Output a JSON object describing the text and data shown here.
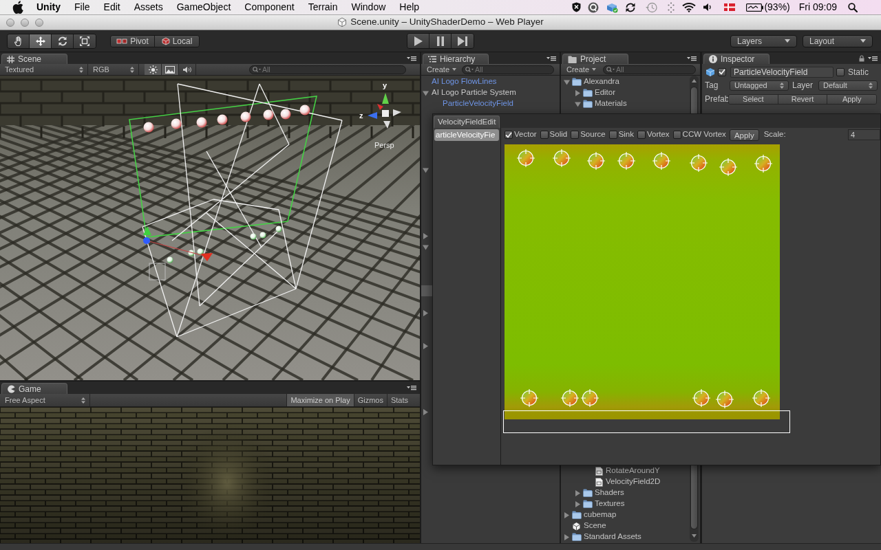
{
  "menu_bar": {
    "app": "Unity",
    "menus": [
      "File",
      "Edit",
      "Assets",
      "GameObject",
      "Component",
      "Terrain",
      "Window",
      "Help"
    ],
    "battery": "(93%)",
    "clock": "Fri 09:09"
  },
  "window": {
    "title": "Scene.unity – UnityShaderDemo – Web Player"
  },
  "toolbar": {
    "tools": [
      {
        "kind": "hand",
        "selected": false
      },
      {
        "kind": "move",
        "selected": true
      },
      {
        "kind": "rotate",
        "selected": false
      },
      {
        "kind": "scale",
        "selected": false
      }
    ],
    "handle_modes": [
      {
        "kind": "pivot",
        "label": "Pivot"
      },
      {
        "kind": "local",
        "label": "Local"
      }
    ],
    "playback": [
      {
        "kind": "play"
      },
      {
        "kind": "pause"
      },
      {
        "kind": "step"
      }
    ],
    "layers": "Layers",
    "layout": "Layout"
  },
  "scene": {
    "tab": "Scene",
    "render_mode": "Textured",
    "color_mode": "RGB",
    "toggles": [
      {
        "kind": "lighting",
        "on": true
      },
      {
        "kind": "skybox",
        "on": true
      },
      {
        "kind": "audio",
        "on": false
      }
    ],
    "search": {
      "placeholder": "All"
    },
    "gizmo": {
      "axes": [
        "y",
        "z"
      ],
      "projection": "Persp"
    }
  },
  "game": {
    "tab": "Game",
    "aspect": "Free Aspect",
    "toggles": [
      {
        "label": "Maximize on Play",
        "on": true
      },
      {
        "label": "Gizmos",
        "on": false
      },
      {
        "label": "Stats",
        "on": false
      }
    ]
  },
  "hierarchy": {
    "tab": "Hierarchy",
    "create": "Create",
    "search": {
      "placeholder": "All"
    },
    "items": [
      {
        "label": "AI Logo FlowLines",
        "prefab": true
      },
      {
        "label": "AI Logo Particle System",
        "prefab": false,
        "expanded": true,
        "children": [
          {
            "label": "ParticleVelocityField",
            "prefab": true
          }
        ]
      }
    ],
    "covered_rows": [
      {
        "selected": false
      },
      {
        "selected": false
      },
      {
        "selected": false
      },
      {
        "selected": false
      },
      {
        "selected": false
      },
      {
        "expanded": true,
        "selected": false
      },
      {
        "selected": false
      },
      {
        "selected": false
      },
      {
        "selected": false
      },
      {
        "selected": false
      },
      {
        "selected": false
      },
      {
        "expanded": false,
        "selected": false
      },
      {
        "expanded": true,
        "selected": false
      },
      {
        "selected": false
      },
      {
        "selected": false
      },
      {
        "selected": false
      },
      {
        "selected": true
      },
      {
        "selected": false
      },
      {
        "expanded": false,
        "selected": false
      },
      {
        "selected": false
      },
      {
        "selected": false
      },
      {
        "expanded": false,
        "selected": false
      },
      {
        "selected": false
      },
      {
        "selected": false
      },
      {
        "selected": false
      },
      {
        "selected": false
      },
      {
        "selected": false
      },
      {
        "expanded": false,
        "selected": false
      },
      {
        "selected": false
      },
      {
        "selected": false
      },
      {
        "selected": false
      },
      {
        "selected": false
      }
    ]
  },
  "project": {
    "tab": "Project",
    "create": "Create",
    "search": {
      "placeholder": "All"
    },
    "tree": [
      {
        "label": "Alexandra",
        "kind": "folder",
        "expanded": true,
        "children": [
          {
            "label": "Editor",
            "kind": "folder",
            "expanded": false
          },
          {
            "label": "Materials",
            "kind": "folder",
            "expanded": true
          },
          {
            "kind": "covered",
            "children": [
              {
                "label": "RotateAroundY",
                "kind": "script"
              },
              {
                "label": "VelocityField2D",
                "kind": "script"
              }
            ]
          },
          {
            "label": "Shaders",
            "kind": "folder",
            "expanded": false
          },
          {
            "label": "Textures",
            "kind": "folder",
            "expanded": false
          }
        ]
      },
      {
        "label": "cubemap",
        "kind": "folder",
        "expanded": false
      },
      {
        "label": "Scene",
        "kind": "scene"
      },
      {
        "label": "Standard Assets",
        "kind": "folder",
        "expanded": false
      }
    ]
  },
  "inspector": {
    "tab": "Inspector",
    "active": true,
    "name": "ParticleVelocityField",
    "static": {
      "label": "Static",
      "checked": false
    },
    "tag": {
      "label": "Tag",
      "value": "Untagged"
    },
    "layer": {
      "label": "Layer",
      "value": "Default"
    },
    "prefab": {
      "label": "Prefab",
      "buttons": [
        "Select",
        "Revert",
        "Apply"
      ]
    }
  },
  "velocity_field_editor": {
    "tab": "VelocityFieldEdit",
    "objects": [
      {
        "label": "articleVelocityFie",
        "selected": true
      }
    ],
    "brushes": [
      {
        "label": "Vector",
        "checked": true
      },
      {
        "label": "Solid",
        "checked": false
      },
      {
        "label": "Source",
        "checked": false
      },
      {
        "label": "Sink",
        "checked": false
      },
      {
        "label": "Vortex",
        "checked": false
      },
      {
        "label": "CCW Vortex",
        "checked": false
      }
    ],
    "apply": "Apply",
    "scale": {
      "label": "Scale:",
      "value": "4"
    }
  }
}
